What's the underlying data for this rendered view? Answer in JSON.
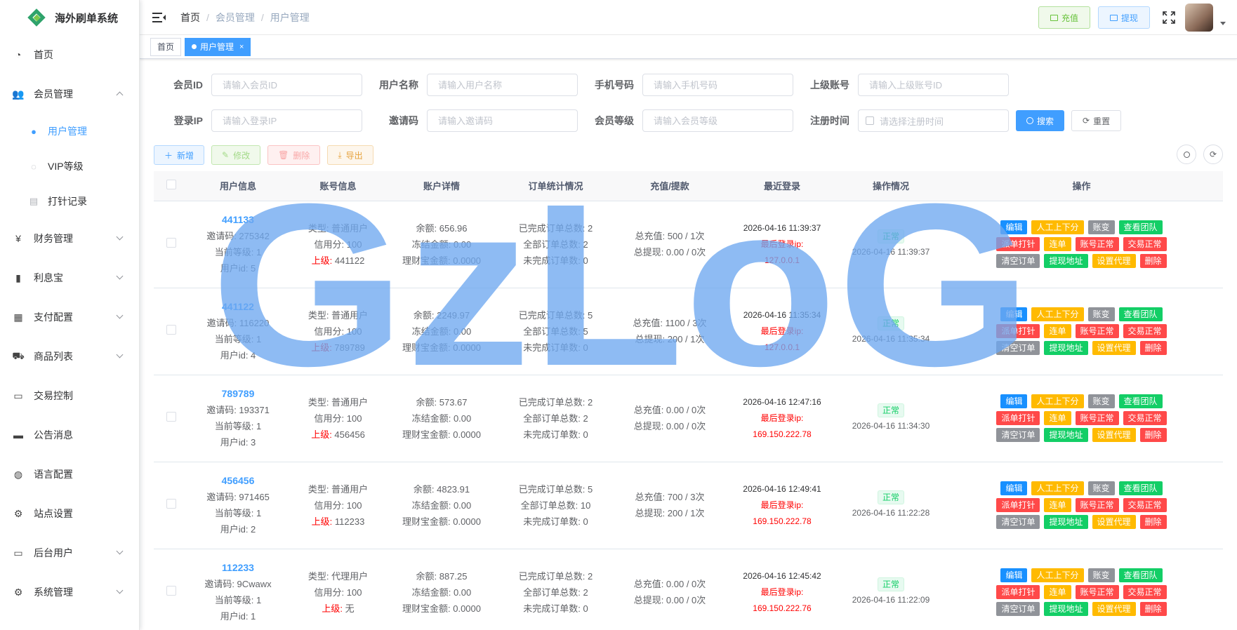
{
  "app": {
    "title": "海外刷单系统"
  },
  "sidebar": {
    "items": [
      {
        "label": "首页",
        "icon": "dashboard-icon",
        "expandable": false
      },
      {
        "label": "会员管理",
        "icon": "user-group-icon",
        "expandable": true,
        "expanded": true,
        "children": [
          {
            "label": "用户管理",
            "icon": "user-icon",
            "active": true
          },
          {
            "label": "VIP等级",
            "icon": "shield-icon",
            "active": false
          },
          {
            "label": "打针记录",
            "icon": "document-icon",
            "active": false
          }
        ]
      },
      {
        "label": "财务管理",
        "icon": "yen-icon",
        "expandable": true
      },
      {
        "label": "利息宝",
        "icon": "bar-chart-icon",
        "expandable": true
      },
      {
        "label": "支付配置",
        "icon": "payment-icon",
        "expandable": true
      },
      {
        "label": "商品列表",
        "icon": "cart-icon",
        "expandable": true
      },
      {
        "label": "交易控制",
        "icon": "monitor-icon",
        "expandable": false
      },
      {
        "label": "公告消息",
        "icon": "message-icon",
        "expandable": false
      },
      {
        "label": "语言配置",
        "icon": "globe-icon",
        "expandable": false
      },
      {
        "label": "站点设置",
        "icon": "gear-icon",
        "expandable": false
      },
      {
        "label": "后台用户",
        "icon": "monitor-user-icon",
        "expandable": true
      },
      {
        "label": "系统管理",
        "icon": "gear-icon",
        "expandable": true
      }
    ]
  },
  "header": {
    "breadcrumb": [
      "首页",
      "会员管理",
      "用户管理"
    ],
    "recharge_label": "充值",
    "withdraw_label": "提现"
  },
  "tags": [
    {
      "label": "首页",
      "active": false
    },
    {
      "label": "用户管理",
      "active": true
    }
  ],
  "search": {
    "member_id": {
      "label": "会员ID",
      "placeholder": "请输入会员ID"
    },
    "username": {
      "label": "用户名称",
      "placeholder": "请输入用户名称"
    },
    "phone": {
      "label": "手机号码",
      "placeholder": "请输入手机号码"
    },
    "parent": {
      "label": "上级账号",
      "placeholder": "请输入上级账号ID"
    },
    "login_ip": {
      "label": "登录IP",
      "placeholder": "请输入登录IP"
    },
    "invite": {
      "label": "邀请码",
      "placeholder": "请输入邀请码"
    },
    "level": {
      "label": "会员等级",
      "placeholder": "请输入会员等级"
    },
    "reg_time": {
      "label": "注册时间",
      "placeholder": "请选择注册时间"
    },
    "search_label": "搜索",
    "reset_label": "重置"
  },
  "toolbar": {
    "add": "新增",
    "edit": "修改",
    "delete": "删除",
    "export": "导出"
  },
  "table": {
    "headers": [
      "用户信息",
      "账号信息",
      "账户详情",
      "订单统计情况",
      "充值/提款",
      "最近登录",
      "操作情况",
      "操作"
    ],
    "labels": {
      "invite": "邀请码: ",
      "level": "当前等级: ",
      "uid": "用户id: ",
      "type": "类型: ",
      "credit": "信用分: ",
      "parent": "上级: ",
      "balance": "余额: ",
      "frozen": "冻结金额: ",
      "wealth": "理财宝金额: ",
      "done": "已完成订单总数: ",
      "all": "全部订单总数: ",
      "undone": "未完成订单数: ",
      "total_recharge": "总充值: ",
      "total_withdraw": "总提现: ",
      "last_ip": "最后登录ip:"
    },
    "ops": [
      "编辑",
      "人工上下分",
      "账变",
      "查看团队",
      "派单打针",
      "连单",
      "账号正常",
      "交易正常",
      "清空订单",
      "提现地址",
      "设置代理",
      "删除"
    ],
    "rows": [
      {
        "id": "441133",
        "invite": "275342",
        "level": "1",
        "uid": "5",
        "type": "普通用户",
        "credit": "100",
        "parent": "441122",
        "balance": "656.96",
        "frozen": "0.00",
        "wealth": "0.0000",
        "done": "2",
        "all": "2",
        "undone": "0",
        "recharge": "500 / 1次",
        "withdraw": "0.00 / 0次",
        "login_time": "2026-04-16 11:39:37",
        "ip": "127.0.0.1",
        "status": "正常",
        "status_time": "2026-04-16 11:39:37"
      },
      {
        "id": "441122",
        "invite": "116220",
        "level": "1",
        "uid": "4",
        "type": "普通用户",
        "credit": "100",
        "parent": "789789",
        "balance": "2249.97",
        "frozen": "0.00",
        "wealth": "0.0000",
        "done": "5",
        "all": "5",
        "undone": "0",
        "recharge": "1100 / 3次",
        "withdraw": "200 / 1次",
        "login_time": "2026-04-16 11:35:34",
        "ip": "127.0.0.1",
        "status": "正常",
        "status_time": "2026-04-16 11:35:34"
      },
      {
        "id": "789789",
        "invite": "193371",
        "level": "1",
        "uid": "3",
        "type": "普通用户",
        "credit": "100",
        "parent": "456456",
        "balance": "573.67",
        "frozen": "0.00",
        "wealth": "0.0000",
        "done": "2",
        "all": "2",
        "undone": "0",
        "recharge": "0.00 / 0次",
        "withdraw": "0.00 / 0次",
        "login_time": "2026-04-16 12:47:16",
        "ip": "169.150.222.78",
        "status": "正常",
        "status_time": "2026-04-16 11:34:30"
      },
      {
        "id": "456456",
        "invite": "971465",
        "level": "1",
        "uid": "2",
        "type": "普通用户",
        "credit": "100",
        "parent": "112233",
        "balance": "4823.91",
        "frozen": "0.00",
        "wealth": "0.0000",
        "done": "5",
        "all": "10",
        "undone": "0",
        "recharge": "700 / 3次",
        "withdraw": "200 / 1次",
        "login_time": "2026-04-16 12:49:41",
        "ip": "169.150.222.78",
        "status": "正常",
        "status_time": "2026-04-16 11:22:28"
      },
      {
        "id": "112233",
        "invite": "9Cwawx",
        "level": "1",
        "uid": "1",
        "type": "代理用户",
        "credit": "100",
        "parent": "无",
        "balance": "887.25",
        "frozen": "0.00",
        "wealth": "0.0000",
        "done": "2",
        "all": "2",
        "undone": "0",
        "recharge": "0.00 / 0次",
        "withdraw": "0.00 / 0次",
        "login_time": "2026-04-16 12:45:42",
        "ip": "169.150.222.76",
        "status": "正常",
        "status_time": "2026-04-16 11:22:09"
      }
    ]
  },
  "watermark": {
    "text": "GzLoG"
  },
  "colors": {
    "primary": "#409eff",
    "success": "#13ce66",
    "warning": "#ffba00",
    "danger": "#ff4949",
    "info": "#909399",
    "watermark": "#6ea8f0"
  }
}
